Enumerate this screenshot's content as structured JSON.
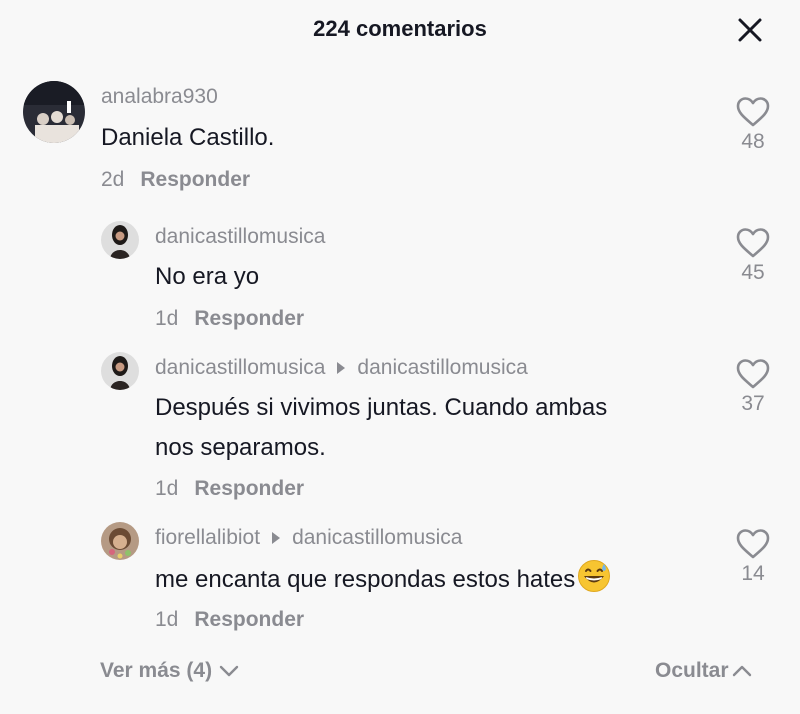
{
  "header": {
    "title": "224 comentarios",
    "close_icon": "close-icon"
  },
  "comments": [
    {
      "username": "analabra930",
      "text": "Daniela Castillo.",
      "time": "2d",
      "reply_label": "Responder",
      "likes": "48"
    },
    {
      "username": "danicastillomusica",
      "text": "No era yo",
      "time": "1d",
      "reply_label": "Responder",
      "likes": "45"
    },
    {
      "username": "danicastillomusica",
      "reply_to": "danicastillomusica",
      "text_line1": "Después si vivimos juntas. Cuando ambas",
      "text_line2": "nos separamos.",
      "time": "1d",
      "reply_label": "Responder",
      "likes": "37"
    },
    {
      "username": "fiorellalibiot",
      "reply_to": "danicastillomusica",
      "text": "me encanta que respondas estos hates",
      "emoji": "grinning-sweat-emoji",
      "time": "1d",
      "reply_label": "Responder",
      "likes": "14"
    }
  ],
  "footer": {
    "more_label": "Ver más (4)",
    "hide_label": "Ocultar"
  },
  "colors": {
    "text": "#161823",
    "muted": "#8a8b91",
    "background": "#f8f8f8"
  }
}
